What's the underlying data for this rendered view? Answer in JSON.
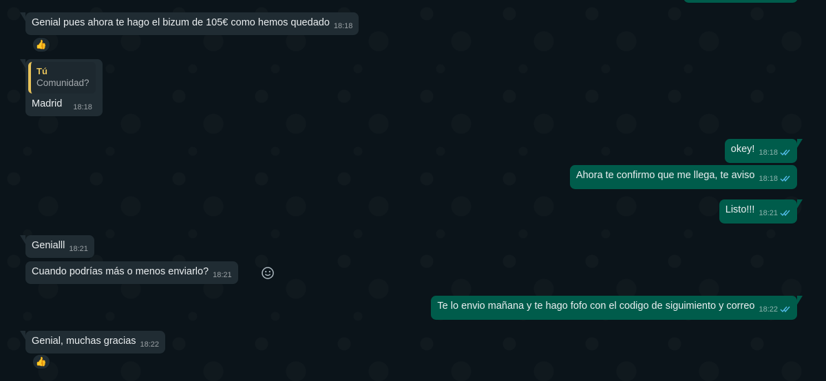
{
  "conversation": {
    "messages": [
      {
        "text": "Genial pues ahora te hago el bizum de 105€ como hemos quedado",
        "time": "18:18",
        "reaction": "👍"
      },
      {
        "quote_author": "Tú",
        "quote_text": "Comunidad?",
        "text": "Madrid",
        "time": "18:18"
      },
      {
        "text": "okey!",
        "time": "18:18"
      },
      {
        "text": "Ahora te confirmo que me llega, te aviso",
        "time": "18:18"
      },
      {
        "text": "Listo!!!",
        "time": "18:21"
      },
      {
        "text": "Genialll",
        "time": "18:21"
      },
      {
        "text": "Cuando podrías más o menos enviarlo?",
        "time": "18:21"
      },
      {
        "text": "Te lo envio mañana y te hago fofo con el codigo de siguimiento y correo",
        "time": "18:22"
      },
      {
        "text": "Genial, muchas gracias",
        "time": "18:22",
        "reaction": "👍"
      }
    ]
  },
  "colors": {
    "background": "#0b141a",
    "incoming_bubble": "#202c33",
    "outgoing_bubble": "#005c4b",
    "read_ticks": "#53bdeb",
    "quote_accent": "#e8c35a"
  },
  "icons": {
    "read_receipt": "double-check-icon",
    "reaction_picker": "smiley-icon",
    "reaction": "thumbs-up-icon"
  }
}
